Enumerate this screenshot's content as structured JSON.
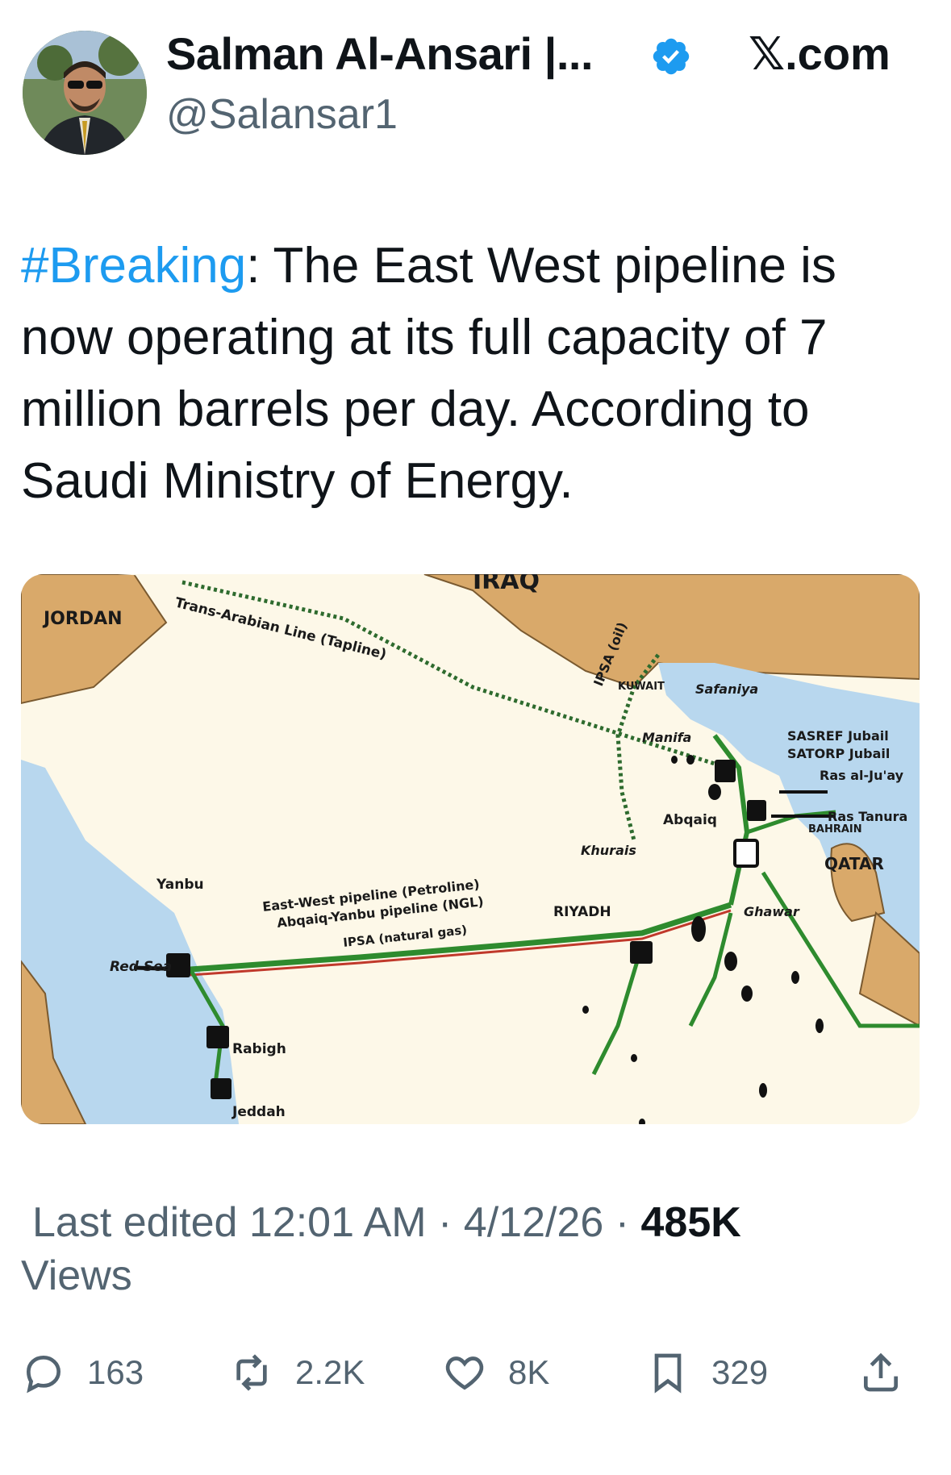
{
  "author": {
    "name": "Salman Al-Ansari |...",
    "handle": "@Salansar1"
  },
  "source": "𝕏.com",
  "tweet": {
    "hashtag": "#Breaking",
    "text": ": The East West pipeline is now operating at its full capacity of 7 million barrels per day. According to Saudi Ministry of Energy."
  },
  "map": {
    "labels": {
      "iraq": "IRAQ",
      "jordan": "JORDAN",
      "tapline": "Trans-Arabian Line (Tapline)",
      "ipsa_oil": "IPSA (oil)",
      "kuwait": "KUWAIT",
      "safaniya": "Safaniya",
      "manifa": "Manifa",
      "sasref": "SASREF Jubail",
      "satorp": "SATORP Jubail",
      "ras_aljuay": "Ras al-Ju'ay",
      "ras_tanura": "Ras Tanura",
      "bahrain": "BAHRAIN",
      "abqaiq": "Abqaiq",
      "khurais": "Khurais",
      "qatar": "QATAR",
      "yanbu": "Yanbu",
      "ew_pipeline": "East-West pipeline (Petroline)",
      "abqaiq_yanbu": "Abqaiq-Yanbu pipeline (NGL)",
      "ipsa_gas": "IPSA (natural gas)",
      "riyadh": "RIYADH",
      "ghawar": "Ghawar",
      "red_sea": "Red Sea",
      "rabigh": "Rabigh",
      "jeddah": "Jeddah"
    }
  },
  "meta": {
    "edited": "Last edited 12:01 AM · 4/12/26 · ",
    "views_count": "485K",
    "views_label": "Views"
  },
  "actions": {
    "replies": "163",
    "reposts": "2.2K",
    "likes": "8K",
    "bookmarks": "329"
  },
  "colors": {
    "accent": "#1d9bf0",
    "pipeline_green": "#2e8b2e",
    "pipeline_red": "#c0392b",
    "land": "#d9a96a",
    "sea": "#b8d7ee",
    "desert": "#fdf8e8"
  }
}
